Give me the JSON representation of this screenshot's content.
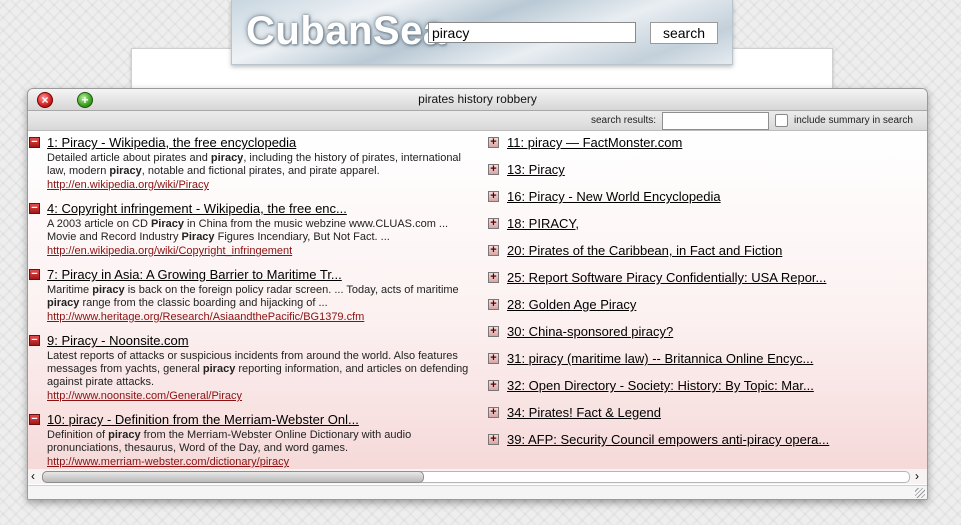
{
  "header": {
    "logo_text": "CubanSea",
    "search_value": "piracy",
    "search_button_label": "search"
  },
  "window": {
    "title": "pirates history robbery",
    "toolbar": {
      "search_results_label": "search results:",
      "filter_value": "",
      "include_summary_label": "include summary in search"
    }
  },
  "icons": {
    "close": "close-icon",
    "zoom": "zoom-icon",
    "expanded": "minus-icon",
    "collapsed": "plus-icon",
    "scroll_left": "chevron-left-icon",
    "scroll_right": "chevron-right-icon"
  },
  "toggle_glyphs": {
    "expanded": "−",
    "collapsed": "+"
  },
  "scroll_glyphs": {
    "left": "‹",
    "right": "›"
  },
  "colors": {
    "link": "#000000",
    "url": "#8b1212",
    "expand_toggle": "#c02020"
  },
  "results_left": [
    {
      "title": "1: Piracy - Wikipedia, the free encyclopedia",
      "summary_html": "Detailed article about pirates and <b>piracy</b>, including the history of pirates, international law, modern <b>piracy</b>, notable and fictional pirates, and pirate apparel.",
      "url": "http://en.wikipedia.org/wiki/Piracy"
    },
    {
      "title": "4: Copyright infringement - Wikipedia, the free enc...",
      "summary_html": "A 2003 article on CD <b>Piracy</b> in China from the music webzine www.CLUAS.com ... Movie and Record Industry <b>Piracy</b> Figures Incendiary, But Not Fact. ...",
      "url": "http://en.wikipedia.org/wiki/Copyright_infringement"
    },
    {
      "title": "7: Piracy in Asia: A Growing Barrier to Maritime Tr...",
      "summary_html": "Maritime <b>piracy</b> is back on the foreign policy radar screen. ... Today, acts of maritime <b>piracy</b> range from the classic boarding and hijacking of ...",
      "url": "http://www.heritage.org/Research/AsiaandthePacific/BG1379.cfm"
    },
    {
      "title": "9: Piracy - Noonsite.com",
      "summary_html": "Latest reports of attacks or suspicious incidents from around the world. Also features messages from yachts, general <b>piracy</b> reporting information, and articles on defending against pirate attacks.",
      "url": "http://www.noonsite.com/General/Piracy"
    },
    {
      "title": "10: piracy - Definition from the Merriam-Webster Onl...",
      "summary_html": "Definition of <b>piracy</b> from the Merriam-Webster Online Dictionary with audio pronunciations, thesaurus, Word of the Day, and word games.",
      "url": "http://www.merriam-webster.com/dictionary/piracy"
    }
  ],
  "results_right": [
    {
      "title": "11: piracy — FactMonster.com"
    },
    {
      "title": "13: Piracy"
    },
    {
      "title": "16: Piracy - New World Encyclopedia"
    },
    {
      "title": "18: PIRACY,"
    },
    {
      "title": "20: Pirates of the Caribbean, in Fact and Fiction"
    },
    {
      "title": "25: Report Software Piracy Confidentially: USA Repor..."
    },
    {
      "title": "28: Golden Age Piracy"
    },
    {
      "title": "30: China-sponsored piracy?"
    },
    {
      "title": "31: piracy (maritime law) -- Britannica Online Encyc..."
    },
    {
      "title": "32: Open Directory - Society: History: By Topic: Mar..."
    },
    {
      "title": "34: Pirates! Fact & Legend"
    },
    {
      "title": "39: AFP: Security Council empowers anti-piracy opera..."
    }
  ]
}
